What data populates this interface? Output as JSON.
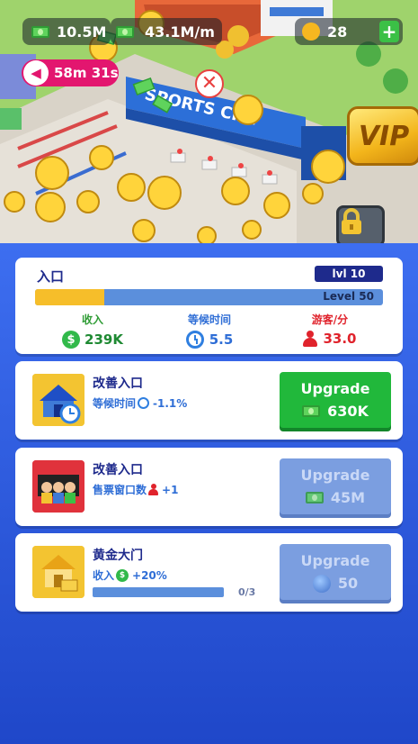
{
  "hud": {
    "cash": "10.5M",
    "income_rate": "43.1M/m",
    "trophies": "28",
    "plus_label": "+",
    "timer": "58m 31s"
  },
  "scene": {
    "gate_sign": "SPORTS CITY",
    "vip_label": "VIP",
    "close_glyph": "✕"
  },
  "stats": {
    "title": "入口",
    "level_badge": "lvl 10",
    "progress_label": "Level 50",
    "progress_fraction": 0.2,
    "income_label": "收入",
    "income_value": "239K",
    "wait_label": "等候时间",
    "wait_value": "5.5",
    "visitors_label": "游客/分",
    "visitors_value": "33.0"
  },
  "upgrades": [
    {
      "title": "改善入口",
      "desc_label": "等候时间",
      "desc_value": "-1.1%",
      "button_label": "Upgrade",
      "price": "630K",
      "enabled": true
    },
    {
      "title": "改善入口",
      "desc_label": "售票窗口数",
      "desc_value": "+1",
      "button_label": "Upgrade",
      "price": "45M",
      "enabled": false
    },
    {
      "title": "黄金大门",
      "desc_label": "收入",
      "desc_value": "+20%",
      "progress_label": "0/3",
      "progress_fraction": 0,
      "button_label": "Upgrade",
      "price": "50",
      "enabled": false
    }
  ],
  "colors": {
    "accent_green": "#21b83b",
    "panel_blue": "#2a56d6",
    "progress_yellow": "#f6be2a",
    "title_navy": "#1e2a8c",
    "timer_pink": "#e3166f"
  }
}
